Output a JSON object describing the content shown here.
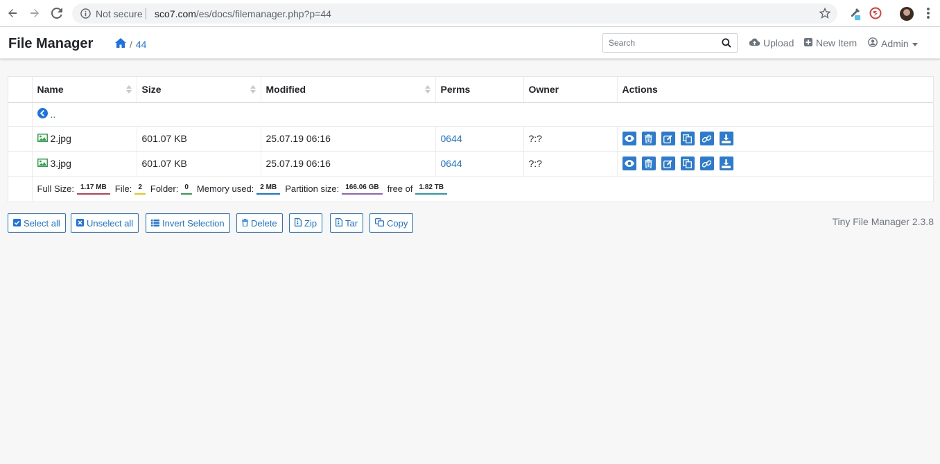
{
  "browser": {
    "security_label": "Not secure",
    "url_host": "sco7.com",
    "url_path": "/es/docs/filemanager.php?p=44"
  },
  "app": {
    "brand": "File Manager",
    "breadcrumb_sep": "/",
    "breadcrumb_folder": "44",
    "search_placeholder": "Search",
    "upload_label": "Upload",
    "new_item_label": "New Item",
    "admin_label": "Admin"
  },
  "table": {
    "headers": [
      "Name",
      "Size",
      "Modified",
      "Perms",
      "Owner",
      "Actions"
    ],
    "parent_link": "..",
    "rows": [
      {
        "name": "2.jpg",
        "size": "601.07 KB",
        "modified": "25.07.19 06:16",
        "perms": "0644",
        "owner": "?:?"
      },
      {
        "name": "3.jpg",
        "size": "601.07 KB",
        "modified": "25.07.19 06:16",
        "perms": "0644",
        "owner": "?:?"
      }
    ],
    "footer": {
      "full_size_label": "Full Size:",
      "full_size": "1.17 MB",
      "file_label": "File:",
      "file_count": "2",
      "folder_label": "Folder:",
      "folder_count": "0",
      "memory_label": "Memory used:",
      "memory": "2 MB",
      "partition_label": "Partition size:",
      "partition": "166.06 GB",
      "free_label": "free of",
      "free": "1.82 TB"
    }
  },
  "buttons": {
    "select_all": "Select all",
    "unselect_all": "Unselect all",
    "invert": "Invert Selection",
    "delete": "Delete",
    "zip": "Zip",
    "tar": "Tar",
    "copy": "Copy"
  },
  "version": "Tiny File Manager 2.3.8",
  "colors": {
    "accent": "#1a73e8",
    "action_button": "#2c7bd0",
    "badge_full_size": "#dc3545",
    "badge_file": "#ffc107",
    "badge_folder": "#28a745",
    "badge_memory": "#007bff",
    "badge_partition": "#9b59d6",
    "badge_free": "#17a2b8"
  },
  "icons": [
    "back-arrow-icon",
    "forward-arrow-icon",
    "reload-icon",
    "info-icon",
    "star-icon",
    "home-icon",
    "search-icon",
    "cloud-upload-icon",
    "plus-square-icon",
    "user-circle-icon",
    "image-file-icon",
    "chevron-left-circle-icon",
    "eye-icon",
    "trash-icon",
    "edit-icon",
    "copy-icon",
    "link-icon",
    "download-icon"
  ]
}
